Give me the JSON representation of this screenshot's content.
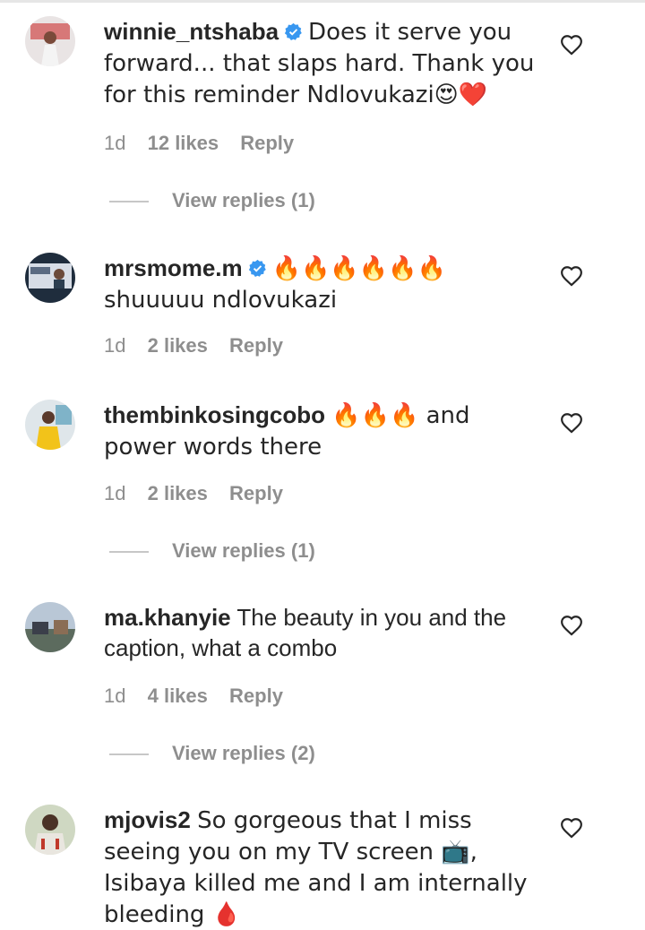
{
  "comments": [
    {
      "username": "winnie_ntshaba",
      "verified": true,
      "body": "Does it serve you forward... that slaps hard. Thank you for this reminder Ndlovukazi😍❤️",
      "time": "1d",
      "likes": "12 likes",
      "reply": "Reply",
      "view_replies": "View replies (1)"
    },
    {
      "username": "mrsmome.m",
      "verified": true,
      "body": "🔥🔥🔥🔥🔥🔥\nshuuuuu ndlovukazi",
      "time": "1d",
      "likes": "2 likes",
      "reply": "Reply",
      "view_replies": ""
    },
    {
      "username": "thembinkosingcobo",
      "verified": false,
      "body": "🔥🔥🔥 and power words there",
      "time": "1d",
      "likes": "2 likes",
      "reply": "Reply",
      "view_replies": "View replies (1)"
    },
    {
      "username": "ma.khanyie",
      "verified": false,
      "body": "The beauty in you and the caption, what a combo",
      "time": "1d",
      "likes": "4 likes",
      "reply": "Reply",
      "view_replies": "View replies (2)"
    },
    {
      "username": "mjovis2",
      "verified": false,
      "body": "So gorgeous that I miss seeing you on my TV screen 📺, Isibaya killed me and I am internally bleeding 🩸",
      "time": "",
      "likes": "",
      "reply": "",
      "view_replies": ""
    }
  ],
  "icons": {
    "like": "heart-outline-icon",
    "verified": "verified-badge-icon"
  },
  "colors": {
    "text": "#262626",
    "muted": "#8e8e8e",
    "verified": "#3897f0",
    "fire": "#f5792a"
  }
}
